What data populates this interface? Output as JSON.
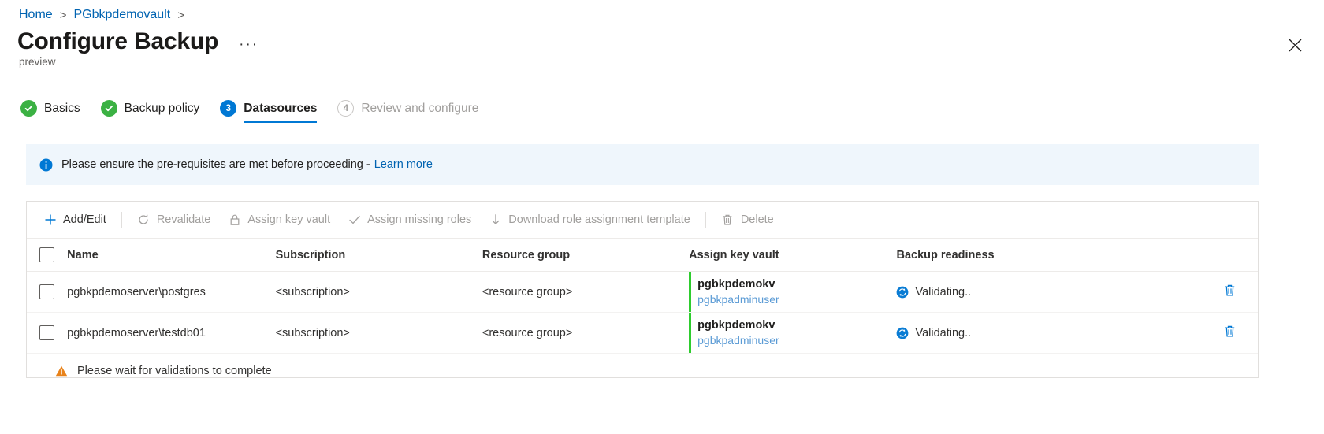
{
  "breadcrumb": {
    "home": "Home",
    "vault": "PGbkpdemovault",
    "separator": ">"
  },
  "header": {
    "title": "Configure Backup",
    "ellipsis": "···",
    "preview": "preview",
    "close_icon": "close-icon"
  },
  "wizard": {
    "steps": [
      {
        "number": "1",
        "label": "Basics",
        "state": "done"
      },
      {
        "number": "2",
        "label": "Backup policy",
        "state": "done"
      },
      {
        "number": "3",
        "label": "Datasources",
        "state": "active"
      },
      {
        "number": "4",
        "label": "Review and configure",
        "state": "pending"
      }
    ]
  },
  "banner": {
    "icon": "info-icon",
    "text": "Please ensure the pre-requisites are met before proceeding -",
    "link": "Learn more",
    "background": "#eff6fc"
  },
  "toolbar": {
    "commands": [
      {
        "label": "Add/Edit",
        "icon": "plus-icon",
        "enabled": true
      },
      {
        "label": "Revalidate",
        "icon": "refresh-icon",
        "enabled": false
      },
      {
        "label": "Assign key vault",
        "icon": "lock-icon",
        "enabled": false
      },
      {
        "label": "Assign missing roles",
        "icon": "check-icon",
        "enabled": false
      },
      {
        "label": "Download role assignment template",
        "icon": "download-icon",
        "enabled": false
      },
      {
        "label": "Delete",
        "icon": "trash-icon",
        "enabled": false
      }
    ]
  },
  "table": {
    "columns": [
      "Name",
      "Subscription",
      "Resource group",
      "Assign key vault",
      "Backup readiness"
    ],
    "rows": [
      {
        "name": "pgbkpdemoserver\\postgres",
        "subscription": "<subscription>",
        "resource_group": "<resource group>",
        "key_vault": "pgbkpdemokv",
        "key_vault_user": "pgbkpadminuser",
        "readiness": "Validating..",
        "readiness_icon": "sync-icon",
        "delete_icon": "trash-icon"
      },
      {
        "name": "pgbkpdemoserver\\testdb01",
        "subscription": "<subscription>",
        "resource_group": "<resource group>",
        "key_vault": "pgbkpdemokv",
        "key_vault_user": "pgbkpadminuser",
        "readiness": "Validating..",
        "readiness_icon": "sync-icon",
        "delete_icon": "trash-icon"
      }
    ]
  },
  "footer": {
    "icon": "warning-icon",
    "message": "Please wait for validations to complete"
  },
  "colors": {
    "accent": "#0078d4",
    "link": "#0063b1",
    "success": "#3bb143",
    "keyvault_bar": "#2ecc2e",
    "warning": "#e8821a",
    "disabled": "#a19f9d"
  }
}
